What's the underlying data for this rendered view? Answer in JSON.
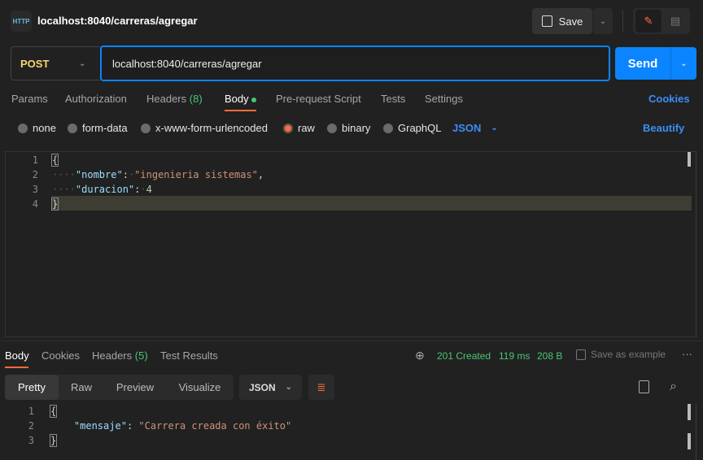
{
  "header": {
    "title": "localhost:8040/carreras/agregar",
    "icon": "http-icon",
    "save_label": "Save"
  },
  "request": {
    "method": "POST",
    "url": "localhost:8040/carreras/agregar",
    "send_label": "Send"
  },
  "tabs": [
    {
      "label": "Params"
    },
    {
      "label": "Authorization"
    },
    {
      "label": "Headers",
      "count": "(8)"
    },
    {
      "label": "Body",
      "active": true
    },
    {
      "label": "Pre-request Script"
    },
    {
      "label": "Tests"
    },
    {
      "label": "Settings"
    }
  ],
  "cookies_label": "Cookies",
  "body_types": [
    {
      "label": "none"
    },
    {
      "label": "form-data"
    },
    {
      "label": "x-www-form-urlencoded"
    },
    {
      "label": "raw",
      "selected": true
    },
    {
      "label": "binary"
    },
    {
      "label": "GraphQL"
    }
  ],
  "body_format": "JSON",
  "beautify_label": "Beautify",
  "request_body": {
    "lines": [
      "1",
      "2",
      "3",
      "4"
    ],
    "open": "{",
    "close": "}",
    "k1": "\"nombre\"",
    "v1": "\"ingenieria sistemas\"",
    "k2": "\"duracion\"",
    "v2": "4"
  },
  "response": {
    "tabs": [
      {
        "label": "Body",
        "active": true
      },
      {
        "label": "Cookies"
      },
      {
        "label": "Headers",
        "count": "(5)"
      },
      {
        "label": "Test Results"
      }
    ],
    "status": "201 Created",
    "time": "119 ms",
    "size": "208 B",
    "save_example": "Save as example",
    "views": [
      "Pretty",
      "Raw",
      "Preview",
      "Visualize"
    ],
    "format": "JSON",
    "lines": [
      "1",
      "2",
      "3"
    ],
    "open": "{",
    "close": "}",
    "k1": "\"mensaje\"",
    "v1": "\"Carrera creada con éxito\""
  },
  "colors": {
    "accent": "#0a84ff",
    "method": "#f5d76e",
    "status": "#49c774",
    "tab_underline": "#ff6c37"
  }
}
